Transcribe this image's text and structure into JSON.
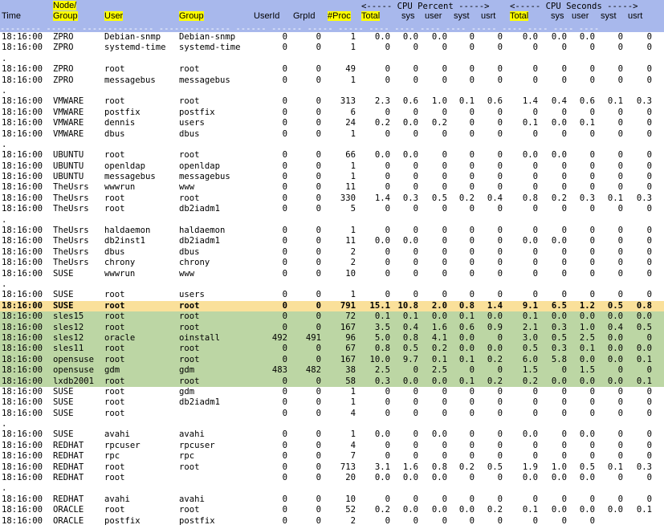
{
  "header": {
    "time": "Time",
    "node_group_line1": "Node/",
    "node_group_line2": "Group",
    "user": "User",
    "group": "Group",
    "userid": "UserId",
    "grpid": "GrpId",
    "nproc": "#Proc",
    "total_pct": "Total",
    "sys_pct": "sys",
    "user_pct": "user",
    "syst_pct": "syst",
    "usrt_pct": "usrt",
    "total_sec": "Total",
    "sys_sec": "sys",
    "user_sec": "user",
    "syst_sec": "syst",
    "usrt_sec": "usrt",
    "cpu_percent_band": "<----- CPU Percent ----->",
    "cpu_seconds_band": "<----- CPU Seconds ----->",
    "dash_line": "-------- ------ -------------- -------------- ------ ------ ----- ----- ---- ---- ---- ---- ----- ---- ---- ---- ----"
  },
  "rows": [
    {
      "t": "18:16:00",
      "n": "ZPRO",
      "u": "Debian-snmp",
      "g": "Debian-snmp",
      "uid": "0",
      "gid": "0",
      "np": "1",
      "tp": "0.0",
      "sp": "0.0",
      "up": "0.0",
      "stp": "0",
      "utp": "0",
      "ts": "0.0",
      "ss": "0.0",
      "us": "0.0",
      "sts": "0",
      "uts": "0"
    },
    {
      "t": "18:16:00",
      "n": "ZPRO",
      "u": "systemd-time",
      "g": "systemd-time",
      "uid": "0",
      "gid": "0",
      "np": "1",
      "tp": "0",
      "sp": "0",
      "up": "0",
      "stp": "0",
      "utp": "0",
      "ts": "0",
      "ss": "0",
      "us": "0",
      "sts": "0",
      "uts": "0"
    },
    {
      "dot": "."
    },
    {
      "t": "18:16:00",
      "n": "ZPRO",
      "u": "root",
      "g": "root",
      "uid": "0",
      "gid": "0",
      "np": "49",
      "tp": "0",
      "sp": "0",
      "up": "0",
      "stp": "0",
      "utp": "0",
      "ts": "0",
      "ss": "0",
      "us": "0",
      "sts": "0",
      "uts": "0"
    },
    {
      "t": "18:16:00",
      "n": "ZPRO",
      "u": "messagebus",
      "g": "messagebus",
      "uid": "0",
      "gid": "0",
      "np": "1",
      "tp": "0",
      "sp": "0",
      "up": "0",
      "stp": "0",
      "utp": "0",
      "ts": "0",
      "ss": "0",
      "us": "0",
      "sts": "0",
      "uts": "0"
    },
    {
      "dot": "."
    },
    {
      "t": "18:16:00",
      "n": "VMWARE",
      "u": "root",
      "g": "root",
      "uid": "0",
      "gid": "0",
      "np": "313",
      "tp": "2.3",
      "sp": "0.6",
      "up": "1.0",
      "stp": "0.1",
      "utp": "0.6",
      "ts": "1.4",
      "ss": "0.4",
      "us": "0.6",
      "sts": "0.1",
      "uts": "0.3"
    },
    {
      "t": "18:16:00",
      "n": "VMWARE",
      "u": "postfix",
      "g": "postfix",
      "uid": "0",
      "gid": "0",
      "np": "6",
      "tp": "0",
      "sp": "0",
      "up": "0",
      "stp": "0",
      "utp": "0",
      "ts": "0",
      "ss": "0",
      "us": "0",
      "sts": "0",
      "uts": "0"
    },
    {
      "t": "18:16:00",
      "n": "VMWARE",
      "u": "dennis",
      "g": "users",
      "uid": "0",
      "gid": "0",
      "np": "24",
      "tp": "0.2",
      "sp": "0.0",
      "up": "0.2",
      "stp": "0",
      "utp": "0",
      "ts": "0.1",
      "ss": "0.0",
      "us": "0.1",
      "sts": "0",
      "uts": "0"
    },
    {
      "t": "18:16:00",
      "n": "VMWARE",
      "u": "dbus",
      "g": "dbus",
      "uid": "0",
      "gid": "0",
      "np": "1",
      "tp": "0",
      "sp": "0",
      "up": "0",
      "stp": "0",
      "utp": "0",
      "ts": "0",
      "ss": "0",
      "us": "0",
      "sts": "0",
      "uts": "0"
    },
    {
      "dot": "."
    },
    {
      "t": "18:16:00",
      "n": "UBUNTU",
      "u": "root",
      "g": "root",
      "uid": "0",
      "gid": "0",
      "np": "66",
      "tp": "0.0",
      "sp": "0.0",
      "up": "0",
      "stp": "0",
      "utp": "0",
      "ts": "0.0",
      "ss": "0.0",
      "us": "0",
      "sts": "0",
      "uts": "0"
    },
    {
      "t": "18:16:00",
      "n": "UBUNTU",
      "u": "openldap",
      "g": "openldap",
      "uid": "0",
      "gid": "0",
      "np": "1",
      "tp": "0",
      "sp": "0",
      "up": "0",
      "stp": "0",
      "utp": "0",
      "ts": "0",
      "ss": "0",
      "us": "0",
      "sts": "0",
      "uts": "0"
    },
    {
      "t": "18:16:00",
      "n": "UBUNTU",
      "u": "messagebus",
      "g": "messagebus",
      "uid": "0",
      "gid": "0",
      "np": "1",
      "tp": "0",
      "sp": "0",
      "up": "0",
      "stp": "0",
      "utp": "0",
      "ts": "0",
      "ss": "0",
      "us": "0",
      "sts": "0",
      "uts": "0"
    },
    {
      "t": "18:16:00",
      "n": "TheUsrs",
      "u": "wwwrun",
      "g": "www",
      "uid": "0",
      "gid": "0",
      "np": "11",
      "tp": "0",
      "sp": "0",
      "up": "0",
      "stp": "0",
      "utp": "0",
      "ts": "0",
      "ss": "0",
      "us": "0",
      "sts": "0",
      "uts": "0"
    },
    {
      "t": "18:16:00",
      "n": "TheUsrs",
      "u": "root",
      "g": "root",
      "uid": "0",
      "gid": "0",
      "np": "330",
      "tp": "1.4",
      "sp": "0.3",
      "up": "0.5",
      "stp": "0.2",
      "utp": "0.4",
      "ts": "0.8",
      "ss": "0.2",
      "us": "0.3",
      "sts": "0.1",
      "uts": "0.3"
    },
    {
      "t": "18:16:00",
      "n": "TheUsrs",
      "u": "root",
      "g": "db2iadm1",
      "uid": "0",
      "gid": "0",
      "np": "5",
      "tp": "0",
      "sp": "0",
      "up": "0",
      "stp": "0",
      "utp": "0",
      "ts": "0",
      "ss": "0",
      "us": "0",
      "sts": "0",
      "uts": "0"
    },
    {
      "dot": "."
    },
    {
      "t": "18:16:00",
      "n": "TheUsrs",
      "u": "haldaemon",
      "g": "haldaemon",
      "uid": "0",
      "gid": "0",
      "np": "1",
      "tp": "0",
      "sp": "0",
      "up": "0",
      "stp": "0",
      "utp": "0",
      "ts": "0",
      "ss": "0",
      "us": "0",
      "sts": "0",
      "uts": "0"
    },
    {
      "t": "18:16:00",
      "n": "TheUsrs",
      "u": "db2inst1",
      "g": "db2iadm1",
      "uid": "0",
      "gid": "0",
      "np": "11",
      "tp": "0.0",
      "sp": "0.0",
      "up": "0",
      "stp": "0",
      "utp": "0",
      "ts": "0.0",
      "ss": "0.0",
      "us": "0",
      "sts": "0",
      "uts": "0"
    },
    {
      "t": "18:16:00",
      "n": "TheUsrs",
      "u": "dbus",
      "g": "dbus",
      "uid": "0",
      "gid": "0",
      "np": "2",
      "tp": "0",
      "sp": "0",
      "up": "0",
      "stp": "0",
      "utp": "0",
      "ts": "0",
      "ss": "0",
      "us": "0",
      "sts": "0",
      "uts": "0"
    },
    {
      "t": "18:16:00",
      "n": "TheUsrs",
      "u": "chrony",
      "g": "chrony",
      "uid": "0",
      "gid": "0",
      "np": "2",
      "tp": "0",
      "sp": "0",
      "up": "0",
      "stp": "0",
      "utp": "0",
      "ts": "0",
      "ss": "0",
      "us": "0",
      "sts": "0",
      "uts": "0"
    },
    {
      "t": "18:16:00",
      "n": "SUSE",
      "u": "wwwrun",
      "g": "www",
      "uid": "0",
      "gid": "0",
      "np": "10",
      "tp": "0",
      "sp": "0",
      "up": "0",
      "stp": "0",
      "utp": "0",
      "ts": "0",
      "ss": "0",
      "us": "0",
      "sts": "0",
      "uts": "0"
    },
    {
      "dot": "."
    },
    {
      "t": "18:16:00",
      "n": "SUSE",
      "u": "root",
      "g": "users",
      "uid": "0",
      "gid": "0",
      "np": "1",
      "tp": "0",
      "sp": "0",
      "up": "0",
      "stp": "0",
      "utp": "0",
      "ts": "0",
      "ss": "0",
      "us": "0",
      "sts": "0",
      "uts": "0"
    },
    {
      "style": "hot",
      "t": "18:16:00",
      "n": "SUSE",
      "u": "root",
      "g": "root",
      "uid": "0",
      "gid": "0",
      "np": "791",
      "tp": "15.1",
      "sp": "10.8",
      "up": "2.0",
      "stp": "0.8",
      "utp": "1.4",
      "ts": "9.1",
      "ss": "6.5",
      "us": "1.2",
      "sts": "0.5",
      "uts": "0.8"
    },
    {
      "style": "green",
      "t": "18:16:00",
      "n": "sles15",
      "u": "root",
      "g": "root",
      "uid": "0",
      "gid": "0",
      "np": "72",
      "tp": "0.1",
      "sp": "0.1",
      "up": "0.0",
      "stp": "0.1",
      "utp": "0.0",
      "ts": "0.1",
      "ss": "0.0",
      "us": "0.0",
      "sts": "0.0",
      "uts": "0.0"
    },
    {
      "style": "green",
      "t": "18:16:00",
      "n": "sles12",
      "u": "root",
      "g": "root",
      "uid": "0",
      "gid": "0",
      "np": "167",
      "tp": "3.5",
      "sp": "0.4",
      "up": "1.6",
      "stp": "0.6",
      "utp": "0.9",
      "ts": "2.1",
      "ss": "0.3",
      "us": "1.0",
      "sts": "0.4",
      "uts": "0.5"
    },
    {
      "style": "green",
      "t": "18:16:00",
      "n": "sles12",
      "u": "oracle",
      "g": "oinstall",
      "uid": "492",
      "gid": "491",
      "np": "96",
      "tp": "5.0",
      "sp": "0.8",
      "up": "4.1",
      "stp": "0.0",
      "utp": "0",
      "ts": "3.0",
      "ss": "0.5",
      "us": "2.5",
      "sts": "0.0",
      "uts": "0"
    },
    {
      "style": "green",
      "t": "18:16:00",
      "n": "sles11",
      "u": "root",
      "g": "root",
      "uid": "0",
      "gid": "0",
      "np": "67",
      "tp": "0.8",
      "sp": "0.5",
      "up": "0.2",
      "stp": "0.0",
      "utp": "0.0",
      "ts": "0.5",
      "ss": "0.3",
      "us": "0.1",
      "sts": "0.0",
      "uts": "0.0"
    },
    {
      "style": "green",
      "t": "18:16:00",
      "n": "opensuse",
      "u": "root",
      "g": "root",
      "uid": "0",
      "gid": "0",
      "np": "167",
      "tp": "10.0",
      "sp": "9.7",
      "up": "0.1",
      "stp": "0.1",
      "utp": "0.2",
      "ts": "6.0",
      "ss": "5.8",
      "us": "0.0",
      "sts": "0.0",
      "uts": "0.1"
    },
    {
      "style": "green",
      "t": "18:16:00",
      "n": "opensuse",
      "u": "gdm",
      "g": "gdm",
      "uid": "483",
      "gid": "482",
      "np": "38",
      "tp": "2.5",
      "sp": "0",
      "up": "2.5",
      "stp": "0",
      "utp": "0",
      "ts": "1.5",
      "ss": "0",
      "us": "1.5",
      "sts": "0",
      "uts": "0"
    },
    {
      "style": "green",
      "t": "18:16:00",
      "n": "lxdb2001",
      "u": "root",
      "g": "root",
      "uid": "0",
      "gid": "0",
      "np": "58",
      "tp": "0.3",
      "sp": "0.0",
      "up": "0.0",
      "stp": "0.1",
      "utp": "0.2",
      "ts": "0.2",
      "ss": "0.0",
      "us": "0.0",
      "sts": "0.0",
      "uts": "0.1"
    },
    {
      "t": "18:16:00",
      "n": "SUSE",
      "u": "root",
      "g": "gdm",
      "uid": "0",
      "gid": "0",
      "np": "1",
      "tp": "0",
      "sp": "0",
      "up": "0",
      "stp": "0",
      "utp": "0",
      "ts": "0",
      "ss": "0",
      "us": "0",
      "sts": "0",
      "uts": "0"
    },
    {
      "t": "18:16:00",
      "n": "SUSE",
      "u": "root",
      "g": "db2iadm1",
      "uid": "0",
      "gid": "0",
      "np": "1",
      "tp": "0",
      "sp": "0",
      "up": "0",
      "stp": "0",
      "utp": "0",
      "ts": "0",
      "ss": "0",
      "us": "0",
      "sts": "0",
      "uts": "0"
    },
    {
      "t": "18:16:00",
      "n": "SUSE",
      "u": "root",
      "g": "",
      "uid": "0",
      "gid": "0",
      "np": "4",
      "tp": "0",
      "sp": "0",
      "up": "0",
      "stp": "0",
      "utp": "0",
      "ts": "0",
      "ss": "0",
      "us": "0",
      "sts": "0",
      "uts": "0"
    },
    {
      "dot": "."
    },
    {
      "t": "18:16:00",
      "n": "SUSE",
      "u": "avahi",
      "g": "avahi",
      "uid": "0",
      "gid": "0",
      "np": "1",
      "tp": "0.0",
      "sp": "0",
      "up": "0.0",
      "stp": "0",
      "utp": "0",
      "ts": "0.0",
      "ss": "0",
      "us": "0.0",
      "sts": "0",
      "uts": "0"
    },
    {
      "t": "18:16:00",
      "n": "REDHAT",
      "u": "rpcuser",
      "g": "rpcuser",
      "uid": "0",
      "gid": "0",
      "np": "4",
      "tp": "0",
      "sp": "0",
      "up": "0",
      "stp": "0",
      "utp": "0",
      "ts": "0",
      "ss": "0",
      "us": "0",
      "sts": "0",
      "uts": "0"
    },
    {
      "t": "18:16:00",
      "n": "REDHAT",
      "u": "rpc",
      "g": "rpc",
      "uid": "0",
      "gid": "0",
      "np": "7",
      "tp": "0",
      "sp": "0",
      "up": "0",
      "stp": "0",
      "utp": "0",
      "ts": "0",
      "ss": "0",
      "us": "0",
      "sts": "0",
      "uts": "0"
    },
    {
      "t": "18:16:00",
      "n": "REDHAT",
      "u": "root",
      "g": "root",
      "uid": "0",
      "gid": "0",
      "np": "713",
      "tp": "3.1",
      "sp": "1.6",
      "up": "0.8",
      "stp": "0.2",
      "utp": "0.5",
      "ts": "1.9",
      "ss": "1.0",
      "us": "0.5",
      "sts": "0.1",
      "uts": "0.3"
    },
    {
      "t": "18:16:00",
      "n": "REDHAT",
      "u": "root",
      "g": "",
      "uid": "0",
      "gid": "0",
      "np": "20",
      "tp": "0.0",
      "sp": "0.0",
      "up": "0.0",
      "stp": "0",
      "utp": "0",
      "ts": "0.0",
      "ss": "0.0",
      "us": "0.0",
      "sts": "0",
      "uts": "0"
    },
    {
      "dot": "."
    },
    {
      "t": "18:16:00",
      "n": "REDHAT",
      "u": "avahi",
      "g": "avahi",
      "uid": "0",
      "gid": "0",
      "np": "10",
      "tp": "0",
      "sp": "0",
      "up": "0",
      "stp": "0",
      "utp": "0",
      "ts": "0",
      "ss": "0",
      "us": "0",
      "sts": "0",
      "uts": "0"
    },
    {
      "t": "18:16:00",
      "n": "ORACLE",
      "u": "root",
      "g": "root",
      "uid": "0",
      "gid": "0",
      "np": "52",
      "tp": "0.2",
      "sp": "0.0",
      "up": "0.0",
      "stp": "0.0",
      "utp": "0.2",
      "ts": "0.1",
      "ss": "0.0",
      "us": "0.0",
      "sts": "0.0",
      "uts": "0.1"
    },
    {
      "t": "18:16:00",
      "n": "ORACLE",
      "u": "postfix",
      "g": "postfix",
      "uid": "0",
      "gid": "0",
      "np": "2",
      "tp": "0",
      "sp": "0",
      "up": "0",
      "stp": "0",
      "utp": "0",
      "ts": "0",
      "ss": "0",
      "us": "0",
      "sts": "",
      "uts": ""
    }
  ]
}
